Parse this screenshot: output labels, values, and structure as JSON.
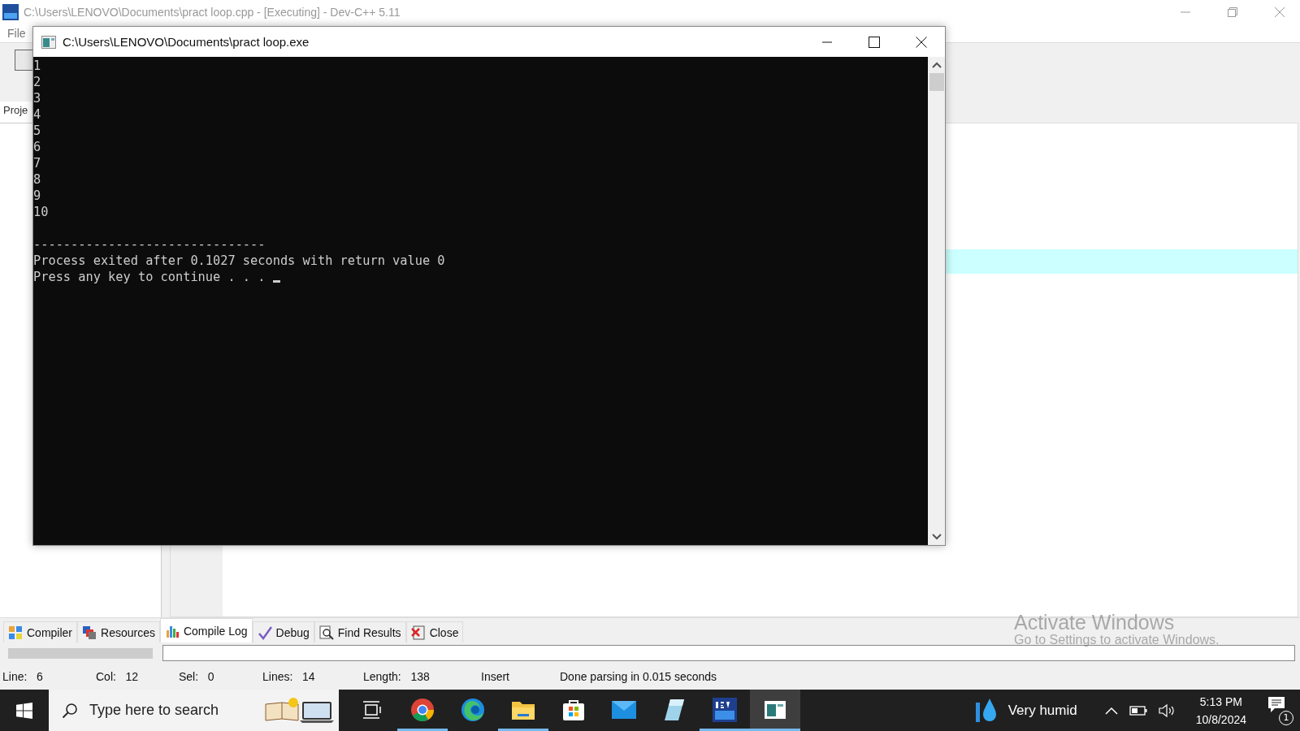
{
  "ide_window": {
    "title": "C:\\Users\\LENOVO\\Documents\\pract loop.cpp - [Executing] - Dev-C++ 5.11",
    "menu": [
      "File"
    ],
    "project_tab": "Proje"
  },
  "bottom_tabs": [
    {
      "label": "Compiler",
      "kind": "compiler",
      "selected": false
    },
    {
      "label": "Resources",
      "kind": "resources",
      "selected": false
    },
    {
      "label": "Compile Log",
      "kind": "log",
      "selected": true
    },
    {
      "label": "Debug",
      "kind": "debug",
      "selected": false
    },
    {
      "label": "Find Results",
      "kind": "find",
      "selected": false
    },
    {
      "label": "Close",
      "kind": "close",
      "selected": false
    }
  ],
  "status_bar": {
    "fields": [
      {
        "label": "Line:",
        "value": "6"
      },
      {
        "label": "Col:",
        "value": "12"
      },
      {
        "label": "Sel:",
        "value": "0"
      },
      {
        "label": "Lines:",
        "value": "14"
      },
      {
        "label": "Length:",
        "value": "138"
      }
    ],
    "mode": "Insert",
    "message": "Done parsing in 0.015 seconds"
  },
  "activation_notice": {
    "title": "Activate Windows",
    "text": "Go to Settings to activate Windows."
  },
  "console_window": {
    "title": "C:\\Users\\LENOVO\\Documents\\pract loop.exe",
    "output": [
      "1",
      "2",
      "3",
      "4",
      "5",
      "6",
      "7",
      "8",
      "9",
      "10"
    ],
    "footer": [
      "-------------------------------",
      "Process exited after 0.1027 seconds with return value 0",
      "Press any key to continue . . . "
    ]
  },
  "compile_progress": {
    "level": 1
  },
  "taskbar": {
    "search": {
      "placeholder": "Type here to search"
    },
    "apps": [
      {
        "kind": "taskview",
        "running": false,
        "selected": false
      },
      {
        "kind": "chrome",
        "running": true,
        "selected": false
      },
      {
        "kind": "edge",
        "running": false,
        "selected": false
      },
      {
        "kind": "explorer",
        "running": true,
        "selected": false
      },
      {
        "kind": "store",
        "running": false,
        "selected": false
      },
      {
        "kind": "mail",
        "running": false,
        "selected": false
      },
      {
        "kind": "notepad",
        "running": false,
        "selected": false
      },
      {
        "kind": "devcpp",
        "running": true,
        "selected": false
      },
      {
        "kind": "console",
        "running": true,
        "selected": true
      }
    ],
    "weather": "Very humid",
    "time": "5:13 PM",
    "date": "10/8/2024",
    "notifications": "1"
  }
}
